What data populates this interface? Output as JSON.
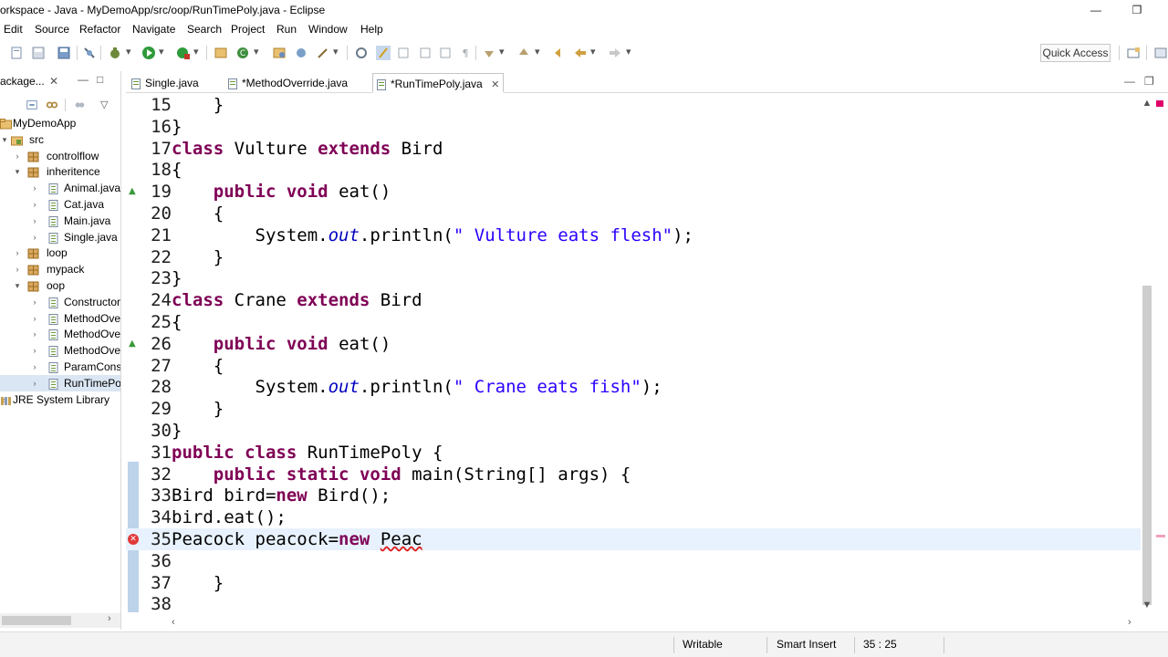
{
  "window": {
    "title": "orkspace - Java - MyDemoApp/src/oop/RunTimePoly.java - Eclipse",
    "minimize": "—",
    "restore": "❐"
  },
  "menu": [
    "Edit",
    "Source",
    "Refactor",
    "Navigate",
    "Search",
    "Project",
    "Run",
    "Window",
    "Help"
  ],
  "toolbar": {
    "quick_access": "Quick Access"
  },
  "explorer": {
    "tab_label": "ackage...",
    "tree": [
      {
        "label": "MyDemoApp",
        "level": 0,
        "arrow": "",
        "icon": "project-icon"
      },
      {
        "label": "src",
        "level": 1,
        "arrow": "▾",
        "icon": "source-folder-icon"
      },
      {
        "label": "controlflow",
        "level": 2,
        "arrow": "›",
        "icon": "package-icon"
      },
      {
        "label": "inheritence",
        "level": 2,
        "arrow": "▾",
        "icon": "package-icon"
      },
      {
        "label": "Animal.java",
        "level": 3,
        "arrow": "›",
        "icon": "java-file-icon"
      },
      {
        "label": "Cat.java",
        "level": 3,
        "arrow": "›",
        "icon": "java-file-icon"
      },
      {
        "label": "Main.java",
        "level": 3,
        "arrow": "›",
        "icon": "java-file-icon"
      },
      {
        "label": "Single.java",
        "level": 3,
        "arrow": "›",
        "icon": "java-file-icon"
      },
      {
        "label": "loop",
        "level": 2,
        "arrow": "›",
        "icon": "package-icon"
      },
      {
        "label": "mypack",
        "level": 2,
        "arrow": "›",
        "icon": "package-icon"
      },
      {
        "label": "oop",
        "level": 2,
        "arrow": "▾",
        "icon": "package-icon"
      },
      {
        "label": "Constructor",
        "level": 3,
        "arrow": "›",
        "icon": "java-file-icon"
      },
      {
        "label": "MethodOve",
        "level": 3,
        "arrow": "›",
        "icon": "java-file-icon"
      },
      {
        "label": "MethodOve",
        "level": 3,
        "arrow": "›",
        "icon": "java-file-icon"
      },
      {
        "label": "MethodOve",
        "level": 3,
        "arrow": "›",
        "icon": "java-file-icon"
      },
      {
        "label": "ParamCons",
        "level": 3,
        "arrow": "›",
        "icon": "java-file-icon"
      },
      {
        "label": "RunTimePo",
        "level": 3,
        "arrow": "›",
        "icon": "java-file-icon",
        "selected": true
      },
      {
        "label": "JRE System Library",
        "level": 0,
        "arrow": "›",
        "icon": "library-icon"
      }
    ]
  },
  "editor_tabs": [
    {
      "label": "Single.java"
    },
    {
      "label": "*MethodOverride.java"
    },
    {
      "label": "*RunTimePoly.java",
      "active": true,
      "close": "✕"
    }
  ],
  "code": [
    {
      "n": "15",
      "t": "    }"
    },
    {
      "n": "16",
      "t": "}"
    },
    {
      "n": "17",
      "t": "class Vulture extends Bird"
    },
    {
      "n": "18",
      "t": "{"
    },
    {
      "n": "19",
      "t": "    public void eat()",
      "marker": "override"
    },
    {
      "n": "20",
      "t": "    {"
    },
    {
      "n": "21",
      "t": "        System.out.println(\" Vulture eats flesh\");"
    },
    {
      "n": "22",
      "t": "    }"
    },
    {
      "n": "23",
      "t": "}"
    },
    {
      "n": "24",
      "t": "class Crane extends Bird"
    },
    {
      "n": "25",
      "t": "{"
    },
    {
      "n": "26",
      "t": "    public void eat()",
      "marker": "override"
    },
    {
      "n": "27",
      "t": "    {"
    },
    {
      "n": "28",
      "t": "        System.out.println(\" Crane eats fish\");"
    },
    {
      "n": "29",
      "t": "    }"
    },
    {
      "n": "30",
      "t": "}"
    },
    {
      "n": "31",
      "t": "public class RunTimePoly {"
    },
    {
      "n": "32",
      "t": "    public static void main(String[] args) {"
    },
    {
      "n": "33",
      "t": "Bird bird=new Bird();"
    },
    {
      "n": "34",
      "t": "bird.eat();"
    },
    {
      "n": "35",
      "t": "Peacock peacock=new Peac",
      "marker": "error",
      "current": true
    },
    {
      "n": "36",
      "t": ""
    },
    {
      "n": "37",
      "t": "    }"
    },
    {
      "n": "38",
      "t": ""
    }
  ],
  "status": {
    "writable": "Writable",
    "insert_mode": "Smart Insert",
    "position": "35 : 25"
  },
  "colors": {
    "keyword": "#7f0055",
    "string": "#2a00ff",
    "field": "#0000c0",
    "current_line": "#e8f2fe",
    "selection": "#dbe6f4"
  }
}
